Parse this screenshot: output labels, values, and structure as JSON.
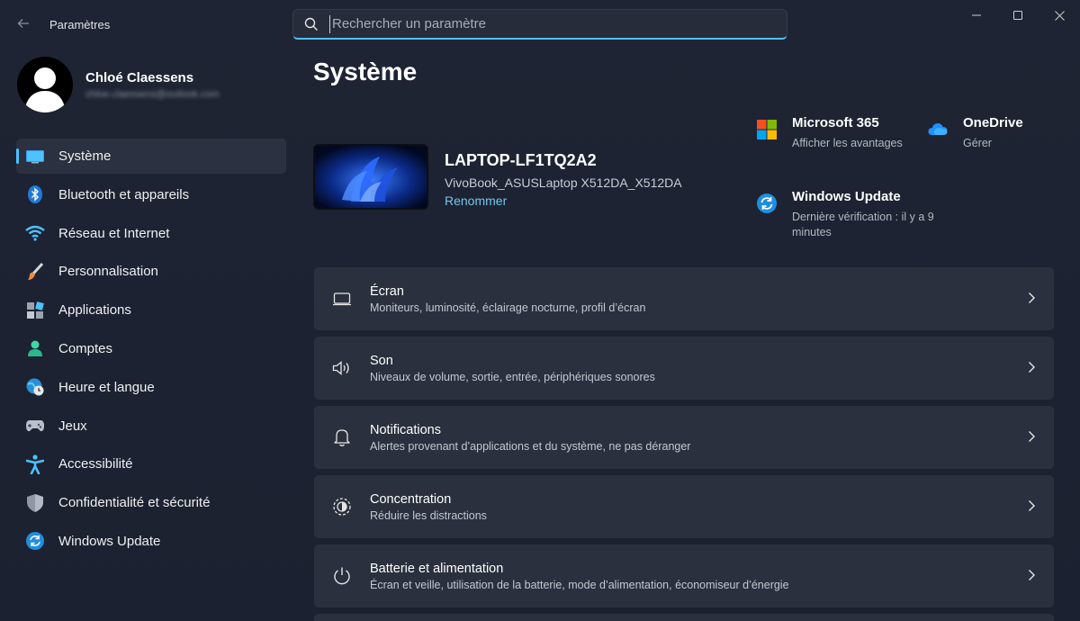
{
  "window": {
    "title": "Paramètres",
    "search_placeholder": "Rechercher un paramètre"
  },
  "profile": {
    "name": "Chloé Claessens",
    "email": "chloe.claessens@outlook.com"
  },
  "nav": [
    {
      "label": "Système",
      "icon": "monitor-icon",
      "active": true
    },
    {
      "label": "Bluetooth et appareils",
      "icon": "bluetooth-icon"
    },
    {
      "label": "Réseau et Internet",
      "icon": "wifi-icon"
    },
    {
      "label": "Personnalisation",
      "icon": "brush-icon"
    },
    {
      "label": "Applications",
      "icon": "apps-icon"
    },
    {
      "label": "Comptes",
      "icon": "person-icon"
    },
    {
      "label": "Heure et langue",
      "icon": "globe-clock-icon"
    },
    {
      "label": "Jeux",
      "icon": "gamepad-icon"
    },
    {
      "label": "Accessibilité",
      "icon": "accessibility-icon"
    },
    {
      "label": "Confidentialité et sécurité",
      "icon": "shield-icon"
    },
    {
      "label": "Windows Update",
      "icon": "update-icon"
    }
  ],
  "main": {
    "title": "Système",
    "device": {
      "name": "LAPTOP-LF1TQ2A2",
      "model": "VivoBook_ASUSLaptop X512DA_X512DA",
      "rename": "Renommer"
    },
    "quick_links": {
      "m365": {
        "title": "Microsoft 365",
        "sub": "Afficher les avantages"
      },
      "onedrive": {
        "title": "OneDrive",
        "sub": "Gérer"
      },
      "update": {
        "title": "Windows Update",
        "sub": "Dernière vérification : il y a 9 minutes"
      }
    },
    "cards": [
      {
        "title": "Écran",
        "sub": "Moniteurs, luminosité, éclairage nocturne, profil d’écran",
        "icon": "display-icon"
      },
      {
        "title": "Son",
        "sub": "Niveaux de volume, sortie, entrée, périphériques sonores",
        "icon": "speaker-icon"
      },
      {
        "title": "Notifications",
        "sub": "Alertes provenant d’applications et du système, ne pas déranger",
        "icon": "bell-icon"
      },
      {
        "title": "Concentration",
        "sub": "Réduire les distractions",
        "icon": "focus-icon"
      },
      {
        "title": "Batterie et alimentation",
        "sub": "Écran et veille, utilisation de la batterie, mode d’alimentation, économiseur d’énergie",
        "icon": "power-icon"
      }
    ]
  },
  "colors": {
    "accent": "#4cc2ff",
    "background": "#1c2230",
    "card": "#2a303d"
  }
}
